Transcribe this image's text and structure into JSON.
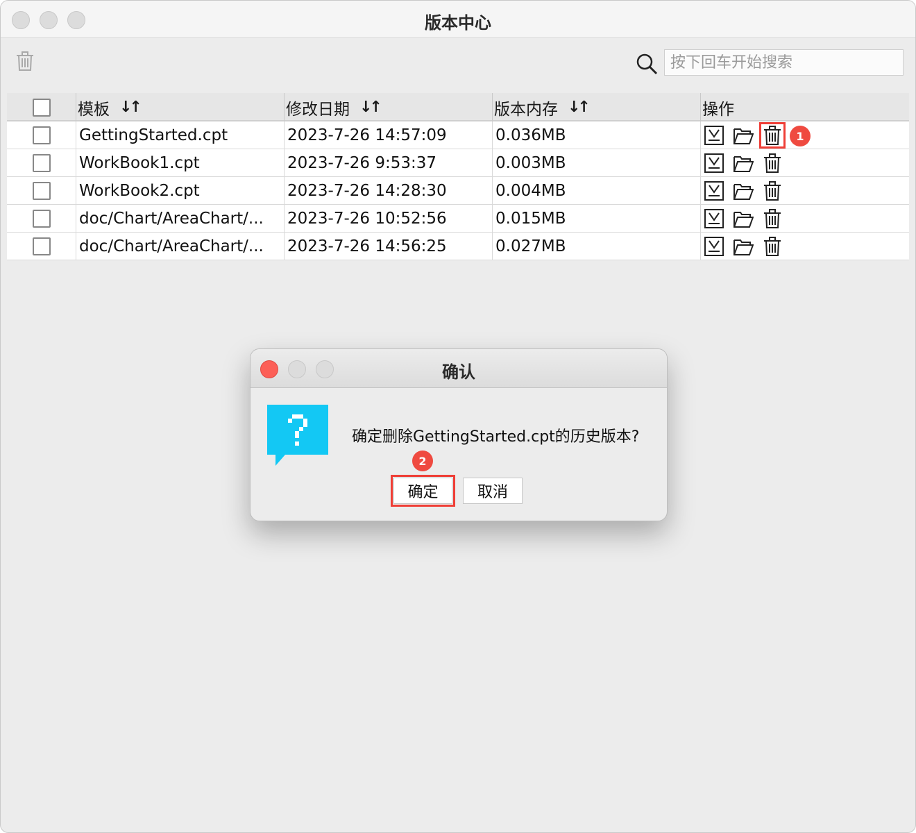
{
  "window": {
    "title": "版本中心"
  },
  "search": {
    "placeholder": "按下回车开始搜索"
  },
  "table": {
    "headers": [
      "模板",
      "修改日期",
      "版本内存",
      "操作"
    ],
    "sort_glyph": "↓↑",
    "rows": [
      {
        "name": "GettingStarted.cpt",
        "date": "2023-7-26 14:57:09",
        "size": "0.036MB"
      },
      {
        "name": "WorkBook1.cpt",
        "date": "2023-7-26 9:53:37",
        "size": "0.003MB"
      },
      {
        "name": "WorkBook2.cpt",
        "date": "2023-7-26 14:28:30",
        "size": "0.004MB"
      },
      {
        "name": "doc/Chart/AreaChart/...",
        "date": "2023-7-26 10:52:56",
        "size": "0.015MB"
      },
      {
        "name": "doc/Chart/AreaChart/...",
        "date": "2023-7-26 14:56:25",
        "size": "0.027MB"
      }
    ],
    "actions": [
      "download-icon",
      "folder-open-icon",
      "trash-icon"
    ]
  },
  "annotations": {
    "step1": "1",
    "step2": "2",
    "highlight_color": "#ef3e36"
  },
  "dialog": {
    "title": "确认",
    "message": "确定删除GettingStarted.cpt的历史版本?",
    "confirm_label": "确定",
    "cancel_label": "取消",
    "icon": "question-icon",
    "icon_color": "#13c8f4"
  }
}
